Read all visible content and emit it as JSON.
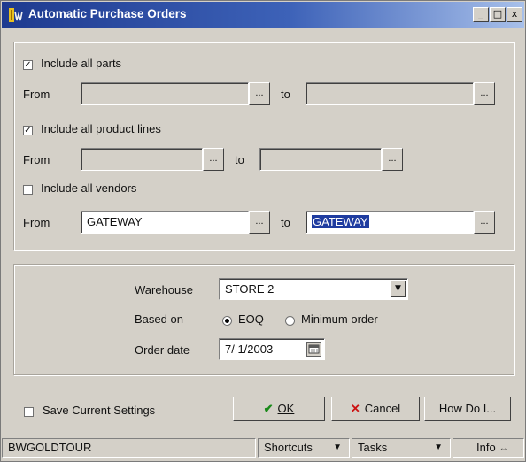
{
  "window": {
    "title": "Automatic Purchase Orders",
    "minimize_glyph": "_",
    "maximize_glyph": "□",
    "close_glyph": "x"
  },
  "parts": {
    "checkbox_label": "Include all parts",
    "checked": true,
    "from_label": "From",
    "to_label": "to",
    "from_value": "",
    "to_value": ""
  },
  "product_lines": {
    "checkbox_label": "Include all product lines",
    "checked": true,
    "from_label": "From",
    "to_label": "to",
    "from_value": "",
    "to_value": ""
  },
  "vendors": {
    "checkbox_label": "Include all vendors",
    "checked": false,
    "from_label": "From",
    "to_label": "to",
    "from_value": "GATEWAY",
    "to_value": "GATEWAY"
  },
  "lookup_button_label": "...",
  "options": {
    "warehouse_label": "Warehouse",
    "warehouse_value": "STORE 2",
    "based_on_label": "Based on",
    "based_on_options": [
      "EOQ",
      "Minimum order"
    ],
    "based_on_selected": "EOQ",
    "order_date_label": "Order date",
    "order_date_value": "7/ 1/2003"
  },
  "footer": {
    "save_settings_label": "Save Current Settings",
    "save_settings_checked": false,
    "ok_label": "OK",
    "cancel_label": "Cancel",
    "howdoi_label": "How Do I..."
  },
  "statusbar": {
    "user": "BWGOLDTOUR",
    "shortcuts_label": "Shortcuts",
    "tasks_label": "Tasks",
    "info_label": "Info"
  },
  "icons": {
    "ok": "check-icon",
    "cancel": "x-icon",
    "dropdown": "chevron-down-icon",
    "calendar": "calendar-icon"
  },
  "colors": {
    "title_start": "#1e3a8f",
    "title_end": "#a8c0ea",
    "ok_check": "#1a8a1a",
    "cancel_x": "#cc1111",
    "selection": "#1f3ca0"
  }
}
